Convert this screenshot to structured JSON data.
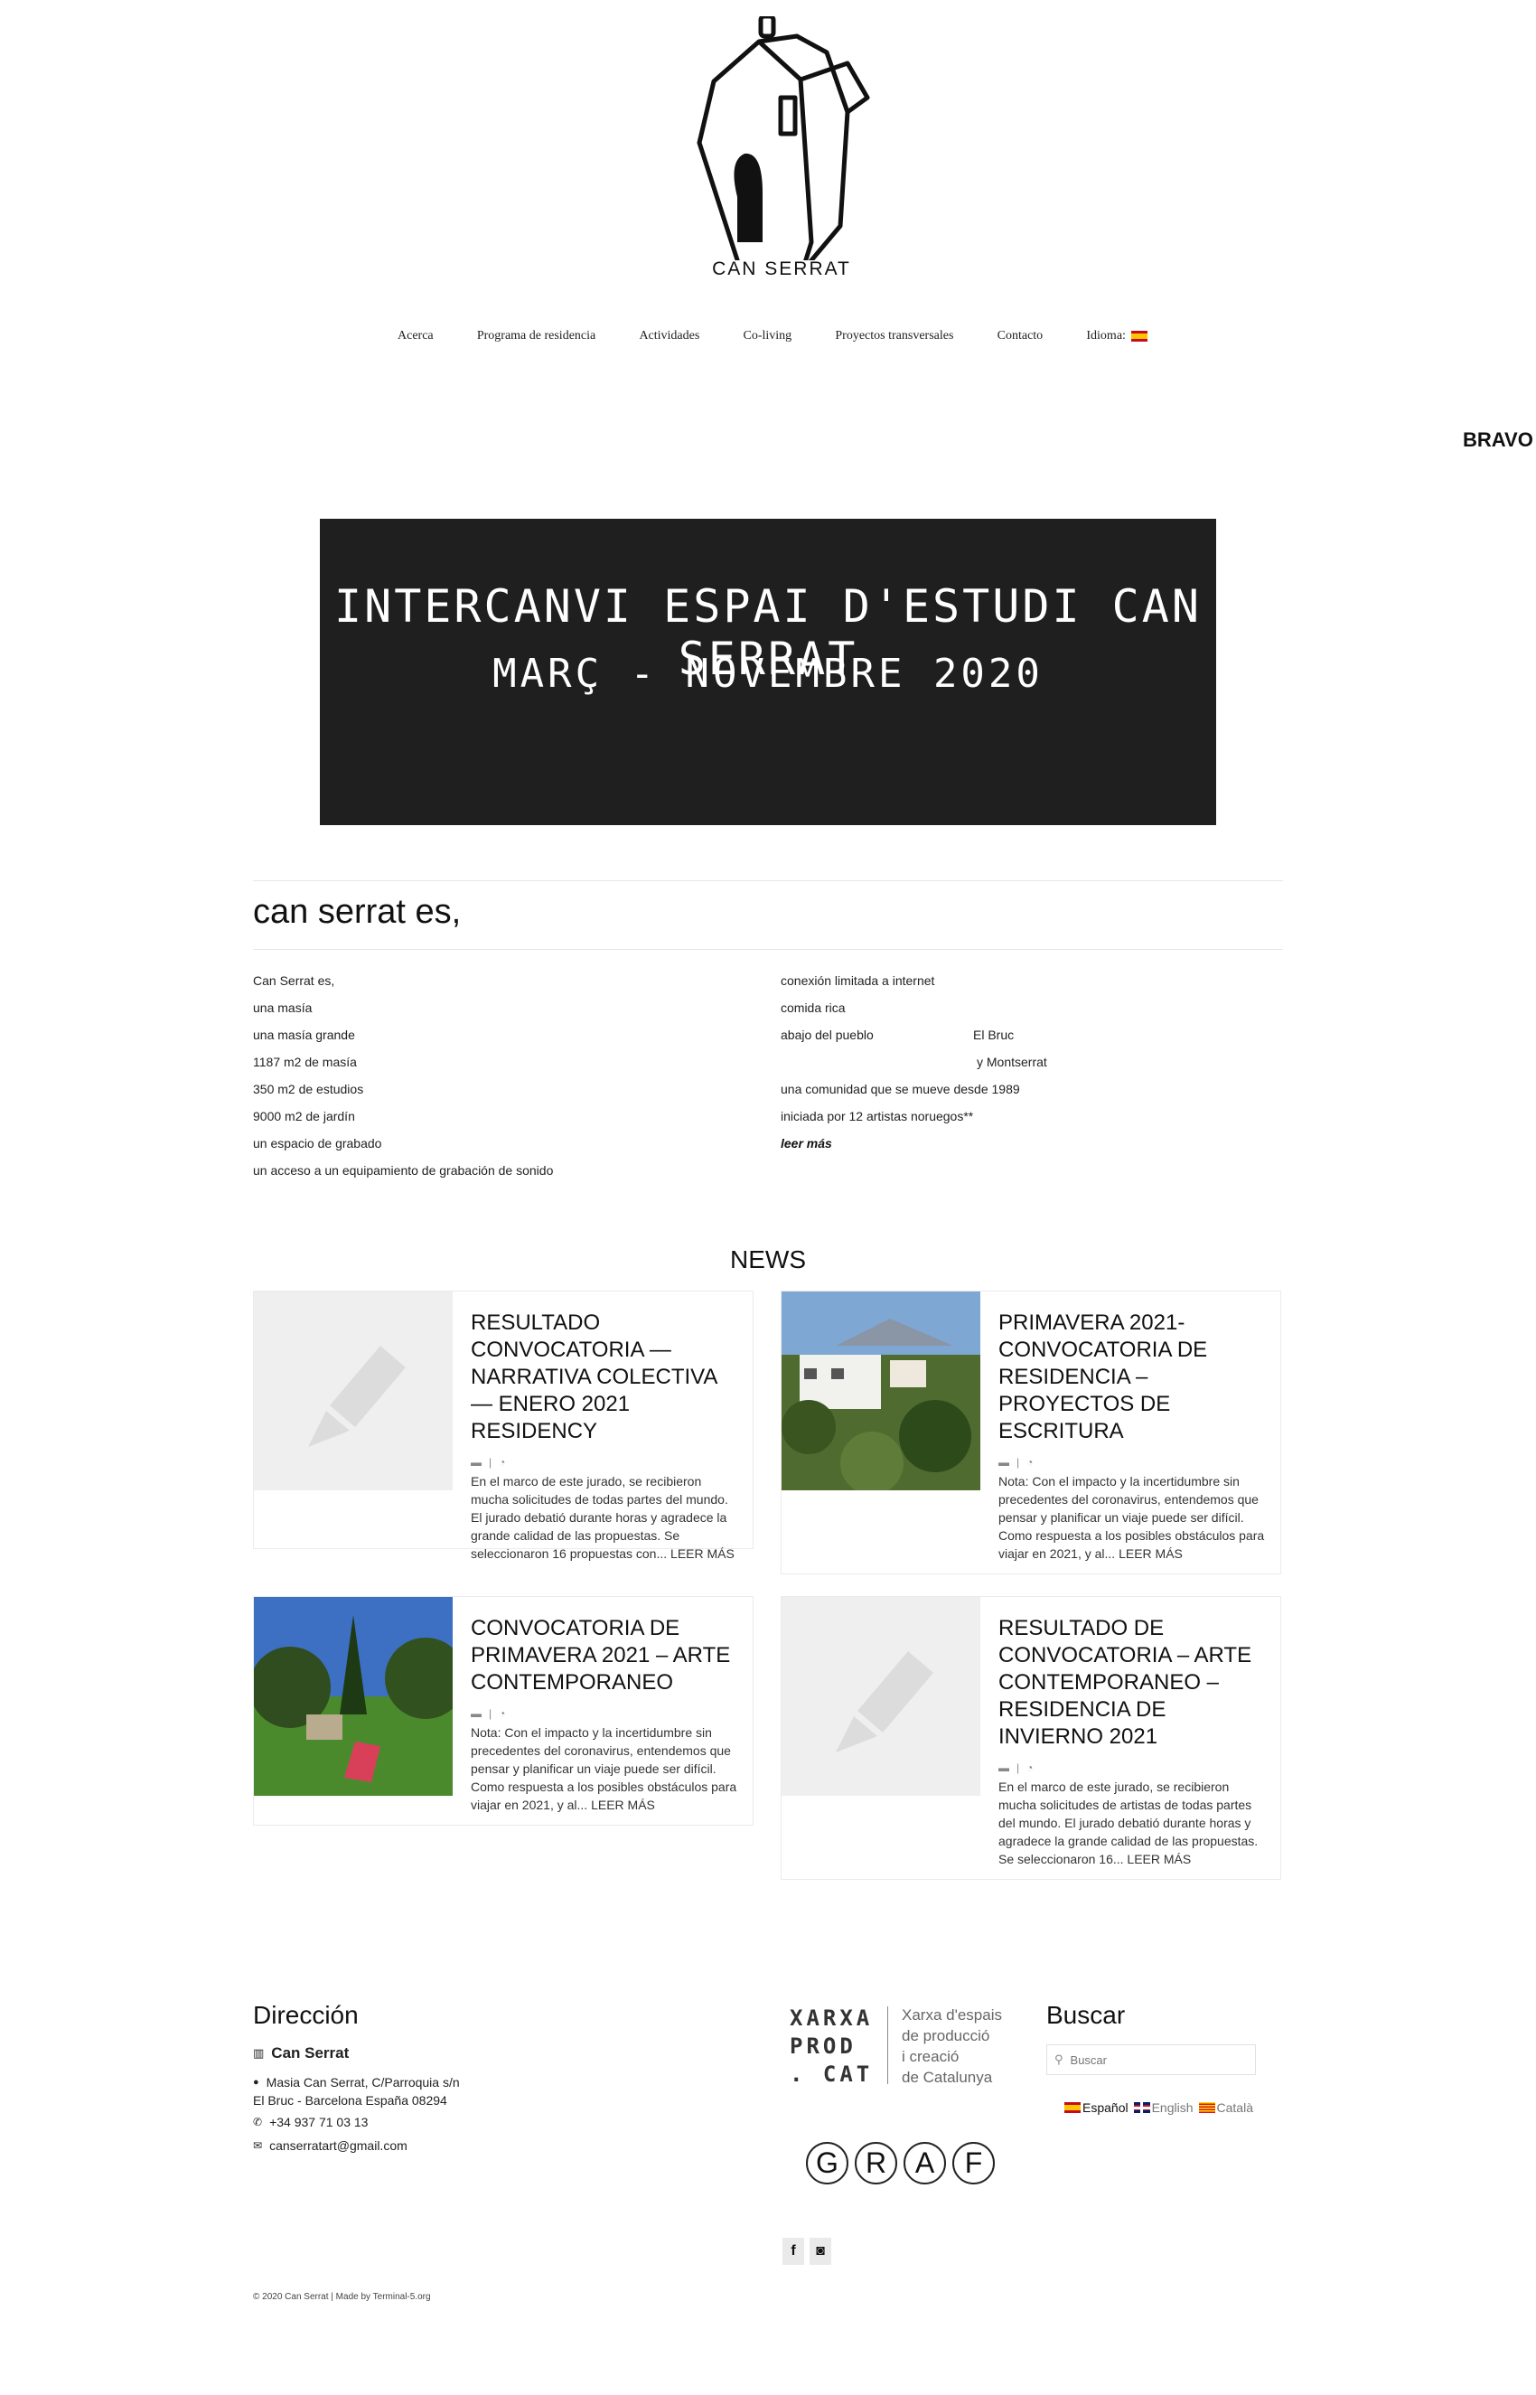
{
  "header": {
    "logo_text": "CAN SERRAT",
    "nav": [
      "Acerca",
      "Programa de residencia",
      "Actividades",
      "Co-living",
      "Proyectos transversales",
      "Contacto",
      "Idioma:"
    ],
    "cut_text": "BRAVO"
  },
  "banner": {
    "line1": "INTERCANVI ESPAI D'ESTUDI CAN SERRAT",
    "line2": "MARÇ - NOVEMBRE 2020"
  },
  "intro": {
    "title": "can serrat es,",
    "left": [
      "Can Serrat es,",
      "una masía",
      "una masía grande",
      "1187 m2 de masía",
      "350 m2 de estudios",
      "9000 m2 de jardín",
      "un espacio de grabado",
      "un acceso a un equipamiento de grabación de sonido"
    ],
    "right": {
      "r1": "conexión limitada a internet",
      "r2": "comida rica",
      "r3": "abajo del pueblo",
      "r3b": "El Bruc",
      "r4b": "y Montserrat",
      "r5": "una comunidad que se mueve desde 1989",
      "r6": "iniciada por 12 artistas noruegos**",
      "read_more": "leer más"
    }
  },
  "news": {
    "title": "NEWS",
    "items": [
      {
        "title": "RESULTADO CONVOCATORIA — NARRATIVA COLECTIVA — ENERO 2021 RESIDENCY",
        "excerpt": "En el marco de este jurado, se recibieron mucha solicitudes de todas partes del mundo. El jurado debatió durante horas y agradece la grande calidad de las propuestas. Se seleccionaron 16 propuestas con...",
        "more": "LEER MÁS"
      },
      {
        "title": "PRIMAVERA 2021- CONVOCATORIA DE RESIDENCIA – PROYECTOS DE ESCRITURA",
        "excerpt": "Nota: Con el impacto y la incertidumbre sin precedentes del coronavirus, entendemos que pensar y planificar un viaje puede ser difícil. Como respuesta a los posibles obstáculos para viajar en 2021, y al...",
        "more": "LEER MÁS"
      },
      {
        "title": "CONVOCATORIA DE PRIMAVERA 2021 – ARTE CONTEMPORANEO",
        "excerpt": " Nota: Con el impacto y la incertidumbre sin precedentes del coronavirus, entendemos que pensar y planificar un viaje puede ser difícil. Como respuesta a los posibles obstáculos para viajar en 2021, y al...",
        "more": "LEER MÁS"
      },
      {
        "title": "RESULTADO DE CONVOCATORIA – ARTE CONTEMPORANEO – RESIDENCIA DE INVIERNO 2021",
        "excerpt": "En el marco de este jurado, se recibieron mucha solicitudes de artistas de todas partes del mundo. El jurado debatió durante horas y agradece la grande calidad de las propuestas. Se seleccionaron 16...",
        "more": "LEER MÁS"
      }
    ]
  },
  "footer": {
    "direccion_title": "Dirección",
    "name": "Can Serrat",
    "address1": "Masia Can Serrat, C/Parroquia s/n",
    "address2": "El Bruc - Barcelona España 08294",
    "phone": "+34 937 71 03 13",
    "email": "canserratart@gmail.com",
    "xarxa_logo": [
      "XARXA",
      "PROD",
      ". CAT"
    ],
    "xarxa_text": [
      "Xarxa d'espais",
      "de producció",
      "i creació",
      "de Catalunya"
    ],
    "graf": [
      "G",
      "R",
      "A",
      "F"
    ],
    "social": [
      "f",
      "◙"
    ],
    "search_title": "Buscar",
    "search_placeholder": "Buscar",
    "languages": [
      "Español",
      "English",
      "Català"
    ],
    "copyright": "© 2020 Can Serrat | Made by Terminal-5.org"
  }
}
